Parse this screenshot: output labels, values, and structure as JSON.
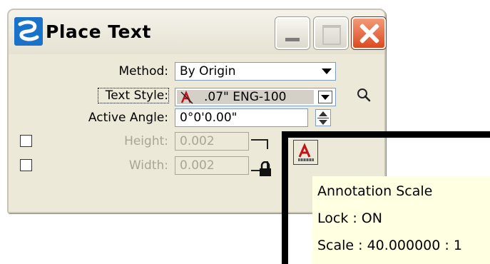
{
  "window": {
    "title": "Place Text",
    "icon": "microstation-logo-icon",
    "controls": [
      "minimize-icon",
      "maximize-icon",
      "close-icon"
    ]
  },
  "form": {
    "method": {
      "label": "Method:",
      "value": "By Origin"
    },
    "text_style": {
      "label": "Text Style:",
      "value": ".07\" ENG-100"
    },
    "active_angle": {
      "label": "Active Angle:",
      "value": "0°0'0.00\""
    },
    "height": {
      "label": "Height:",
      "value": "0.002",
      "enabled": false,
      "checked": false
    },
    "width": {
      "label": "Width:",
      "value": "0.002",
      "enabled": false,
      "checked": false
    },
    "lock": {
      "locked": true
    }
  },
  "tooltip": {
    "line1": "Annotation Scale",
    "line2": "Lock : ON",
    "line3": "Scale : 40.000000 : 1"
  },
  "colors": {
    "dialog_bg": "#ece9d8",
    "tooltip_bg": "#ffffe1",
    "close_red": "#dc4a20",
    "disabled_text": "#a8a595"
  }
}
